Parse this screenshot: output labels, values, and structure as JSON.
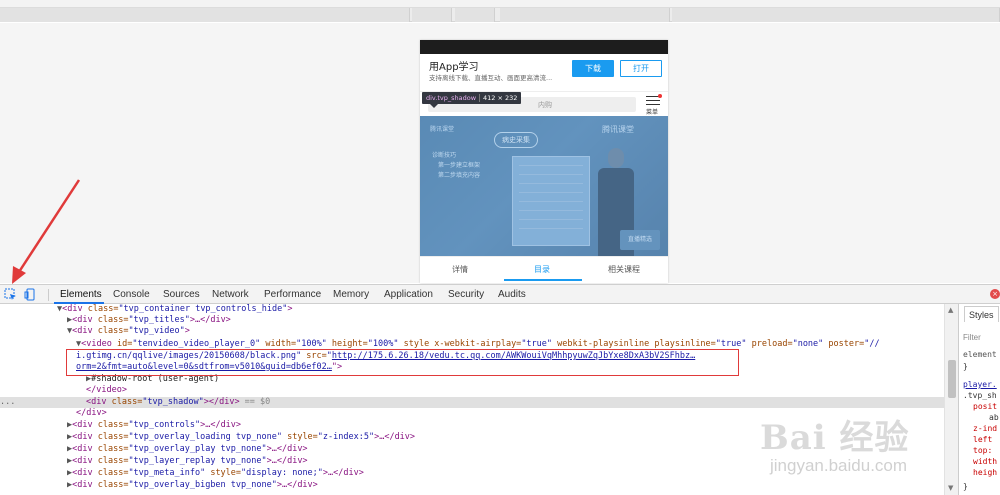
{
  "devtools": {
    "tabs": [
      "Elements",
      "Console",
      "Sources",
      "Network",
      "Performance",
      "Memory",
      "Application",
      "Security",
      "Audits"
    ],
    "active_tab": "Elements",
    "styles_tab": "Styles",
    "filter_placeholder": "Filter"
  },
  "page": {
    "app_title": "用App学习",
    "app_subtitle": "支持离线下载、直播互动、画面更高清流...",
    "download_label": "下载",
    "open_label": "打开",
    "search_text": "内购",
    "menu_label": "菜单",
    "tooltip_tag": "div.tvp_shadow",
    "tooltip_size": "412 × 232",
    "video_bubble": "病史采集",
    "video_text1": "诊断技巧",
    "video_text2": "第一步建立框架",
    "video_text3": "第二步填充内容",
    "video_logo_left": "腾讯课堂",
    "video_logo_right": "腾讯课堂",
    "video_badge": "直播精选",
    "tabs": [
      "详情",
      "目录",
      "相关课程"
    ],
    "active_tab": "目录"
  },
  "dom": {
    "l1_tag": "<div",
    "l1_attr": " class=",
    "l1_val": "\"tvp_container tvp_controls_hide\"",
    "l1_end": ">",
    "l2_tag": "<div",
    "l2_attr": " class=",
    "l2_val": "\"tvp_titles\"",
    "l2_end": ">…</div>",
    "l3_tag": "<div",
    "l3_attr": " class=",
    "l3_val": "\"tvp_video\"",
    "l3_end": ">",
    "l4_tag": "<video",
    "l4_a1": " id=",
    "l4_v1": "\"tenvideo_video_player_0\"",
    "l4_a2": " width=",
    "l4_v2": "\"100%\"",
    "l4_a3": " height=",
    "l4_v3": "\"100%\"",
    "l4_a4": " style x-webkit-airplay=",
    "l4_v4": "\"true\"",
    "l4_a5": " webkit-playsinline playsinline=",
    "l4_v5": "\"true\"",
    "l4_a6": " preload=",
    "l4_v6": "\"none\"",
    "l4_a7": " poster=",
    "l4_v7": "\"//",
    "l5_link": "i.gtimg.cn/qqlive/images/20150608/black.png",
    "l5_v": "\"",
    "l5_attr": " src=",
    "l5_q": "\"",
    "l5_link2": "http://175.6.26.18/vedu.tc.qq.com/AWKWouiVqMhhpyuwZqJbYxe8DxA3bV2SFhbz…",
    "l6_link": "orm=2&fmt=auto&level=0&sdtfrom=v5010&guid=db6ef02…",
    "l6_end": "\">",
    "l7_text": "#shadow-root (user-agent)",
    "l8_tag": "</video>",
    "l9_dots": "...",
    "l9_tag": "<div",
    "l9_attr": " class=",
    "l9_val": "\"tvp_shadow\"",
    "l9_end": "></div>",
    "l9_eq": " == $0",
    "l10_tag": "</div>",
    "l11_tag": "<div",
    "l11_attr": " class=",
    "l11_val": "\"tvp_controls\"",
    "l11_end": ">…</div>",
    "l12_tag": "<div",
    "l12_attr": " class=",
    "l12_val": "\"tvp_overlay_loading tvp_none\"",
    "l12_a2": " style=",
    "l12_v2": "\"z-index:5\"",
    "l12_end": ">…</div>",
    "l13_tag": "<div",
    "l13_attr": " class=",
    "l13_val": "\"tvp_overlay_play tvp_none\"",
    "l13_end": ">…</div>",
    "l14_tag": "<div",
    "l14_attr": " class=",
    "l14_val": "\"tvp_layer_replay tvp_none\"",
    "l14_end": ">…</div>",
    "l15_tag": "<div",
    "l15_attr": " class=",
    "l15_val": "\"tvp_meta_info\"",
    "l15_a2": " style=",
    "l15_v2": "\"display: none;\"",
    "l15_end": ">…</div>",
    "l16_tag": "<div",
    "l16_attr": " class=",
    "l16_val": "\"tvp_overlay_bigben tvp_none\"",
    "l16_end": ">…</div>"
  },
  "styles": {
    "l1": "element",
    "l2": "}",
    "l3": "player.",
    "l4": ".tvp_sh",
    "l5": "posit",
    "l6": "ab",
    "l7": "z-ind",
    "l8": "left",
    "l9": "top:",
    "l10": "width",
    "l11": "heigh",
    "l12": "}"
  },
  "watermark": {
    "logo": "Bai 经验",
    "url": "jingyan.baidu.com"
  },
  "colors": {
    "annotation": "#e03a3a",
    "accent": "#1a9bf0",
    "devtools_active": "#1a73e8"
  }
}
